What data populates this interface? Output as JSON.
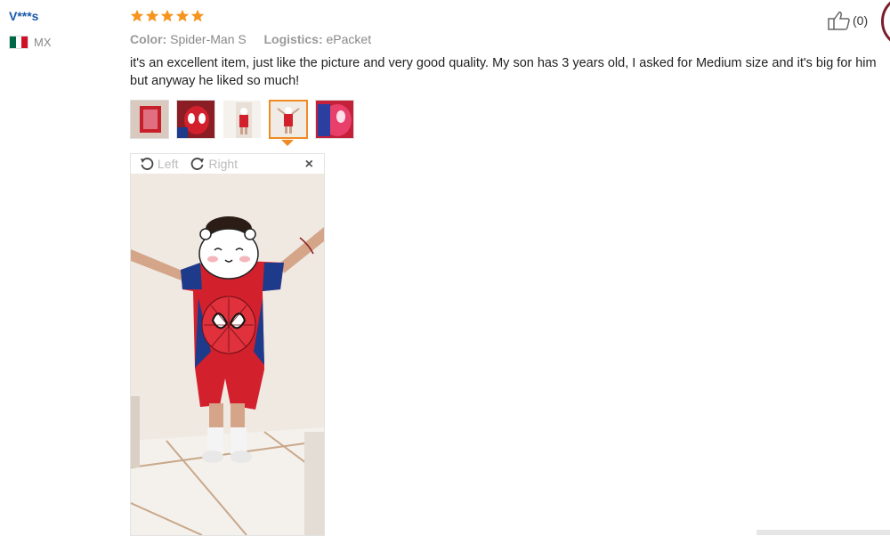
{
  "review": {
    "user_name": "V***s",
    "country_code": "MX",
    "rating": 5,
    "color_label": "Color:",
    "color_value": "Spider-Man S",
    "logistics_label": "Logistics:",
    "logistics_value": "ePacket",
    "text": "it's an excellent item, just like the picture and very good quality. My son has 3 years old, I asked for Medium size and it's big for him but anyway he liked so much!",
    "helpful_count": "(0)"
  },
  "viewer": {
    "rotate_left_label": "Left",
    "rotate_right_label": "Right",
    "close_label": "×",
    "selected_thumbnail_index": 4
  },
  "colors": {
    "username": "#1a5aa8",
    "star": "#f7941d",
    "selected_border": "#f08a24"
  }
}
